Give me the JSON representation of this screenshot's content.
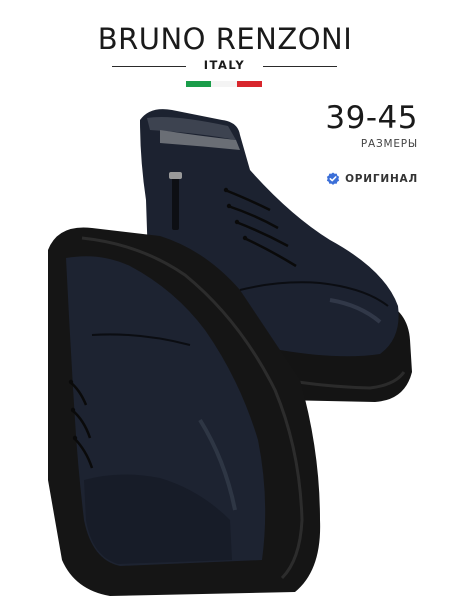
{
  "brand": {
    "name": "BRUNO RENZONI",
    "country": "ITALY"
  },
  "flag_colors": [
    "#1a9d4a",
    "#f4f4f4",
    "#d8262c"
  ],
  "sizes": {
    "range": "39-45",
    "caption": "РАЗМЕРЫ"
  },
  "badge": {
    "label": "ОРИГИНАЛ",
    "icon": "verified-check-icon",
    "color": "#3b6fd8"
  },
  "product": {
    "image": "black-leather-chukka-boots-pair"
  }
}
